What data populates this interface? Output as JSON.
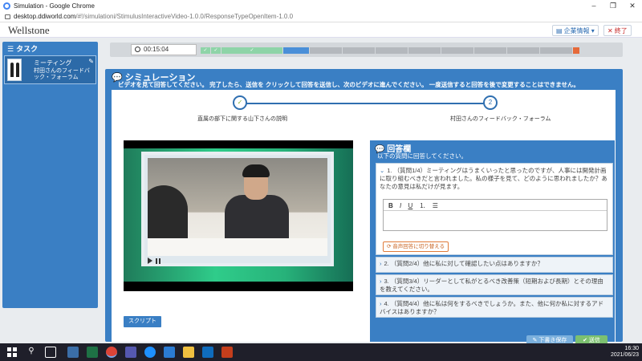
{
  "browser": {
    "title": "Simulation - Google Chrome",
    "url_host": "desktop.ddiworld.com",
    "url_path": "/#!/simulationi/StimulusInteractiveVideo-1.0.0/ResponseTypeOpenItem-1.0.0"
  },
  "header": {
    "brand": "Wellstone",
    "company_info": "企業情報",
    "exit": "終了"
  },
  "sidebar": {
    "title": "タスク",
    "task": {
      "title": "ミーティング",
      "subtitle": "村田さんのフィードバック・フォーラム"
    }
  },
  "timer": {
    "value": "00:15:04"
  },
  "progress": {
    "segments": [
      {
        "state": "done",
        "label": "✓"
      },
      {
        "state": "done",
        "label": "✓"
      },
      {
        "state": "done",
        "label": "✓"
      },
      {
        "state": "current",
        "label": ""
      },
      {
        "state": "todo",
        "label": ""
      },
      {
        "state": "todo",
        "label": ""
      },
      {
        "state": "todo",
        "label": ""
      },
      {
        "state": "todo",
        "label": ""
      },
      {
        "state": "todo",
        "label": ""
      },
      {
        "state": "todo",
        "label": ""
      },
      {
        "state": "todo",
        "label": ""
      },
      {
        "state": "todo",
        "label": ""
      },
      {
        "state": "flag",
        "label": ""
      }
    ]
  },
  "simulation": {
    "title": "シミュレーション",
    "description": "ビデオを見て回答してください。 完了したら、送信を クリックして回答を送信し、次のビデオに進んでください。 一度送信すると回答を後で変更することはできません。"
  },
  "steps": [
    {
      "marker": "✓",
      "label": "直属の部下に関する山下さんの説明"
    },
    {
      "marker": "2",
      "label": "村田さんのフィードバック・フォーラム"
    }
  ],
  "video": {
    "script_button": "スクリプト"
  },
  "answer": {
    "title": "回答欄",
    "subtitle": "以下の質問に回答してください。",
    "questions": [
      {
        "text": "1. （質問1/4）ミーティングはうまくいったと思ったのですが、人事には開発計画に取り組むべきだと言われました。私の様子を見て、どのように思われましたか？あなたの意見は私だけが見ます。"
      },
      {
        "text": "2. （質問2/4）他に私に対して確認したい点はありますか？"
      },
      {
        "text": "3. （質問3/4）リーダーとして私がとるべき改善策（短期および長期）とその理由を教えてください。"
      },
      {
        "text": "4. （質問4/4）他に私は何をするべきでしょうか。また、他に何か私に対するアドバイスはありますか？"
      }
    ],
    "toolbar": {
      "bold": "B",
      "italic": "I",
      "underline": "U"
    },
    "audio_button": "音声回答に切り替える",
    "save_button": "下書き保存",
    "send_button": "送信"
  },
  "taskbar": {
    "time": "16:30",
    "date": "2021/06/23"
  },
  "colors": {
    "primary": "#3a7fc4",
    "done": "#8ed4a8",
    "current": "#4a8fd8",
    "todo": "#b4b8bd",
    "flag": "#e56a3a"
  }
}
